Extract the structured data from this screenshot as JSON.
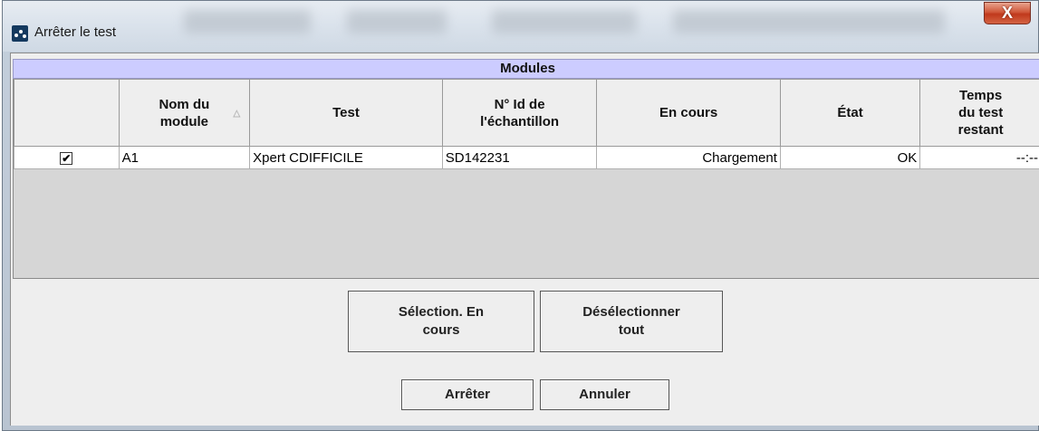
{
  "window": {
    "title": "Arrêter le test",
    "close_label": "X"
  },
  "modules_section": {
    "header": "Modules",
    "columns": [
      {
        "key": "select",
        "label": ""
      },
      {
        "key": "module_name",
        "label": "Nom du\nmodule"
      },
      {
        "key": "test",
        "label": "Test"
      },
      {
        "key": "sample_id",
        "label": "N° Id de\nl'échantillon"
      },
      {
        "key": "in_progress",
        "label": "En cours"
      },
      {
        "key": "state",
        "label": "État"
      },
      {
        "key": "time_remaining",
        "label": "Temps\ndu test\nrestant"
      }
    ],
    "rows": [
      {
        "selected": true,
        "checkbox_glyph": "✔",
        "module_name": "A1",
        "test": "Xpert CDIFFICILE",
        "sample_id": "SD142231",
        "in_progress": "Chargement",
        "state": "OK",
        "time_remaining": "--:--"
      }
    ],
    "sort_indicator": "△"
  },
  "buttons": {
    "select_in_progress": "Sélection. En\ncours",
    "deselect_all": "Désélectionner\ntout",
    "stop": "Arrêter",
    "cancel": "Annuler"
  }
}
